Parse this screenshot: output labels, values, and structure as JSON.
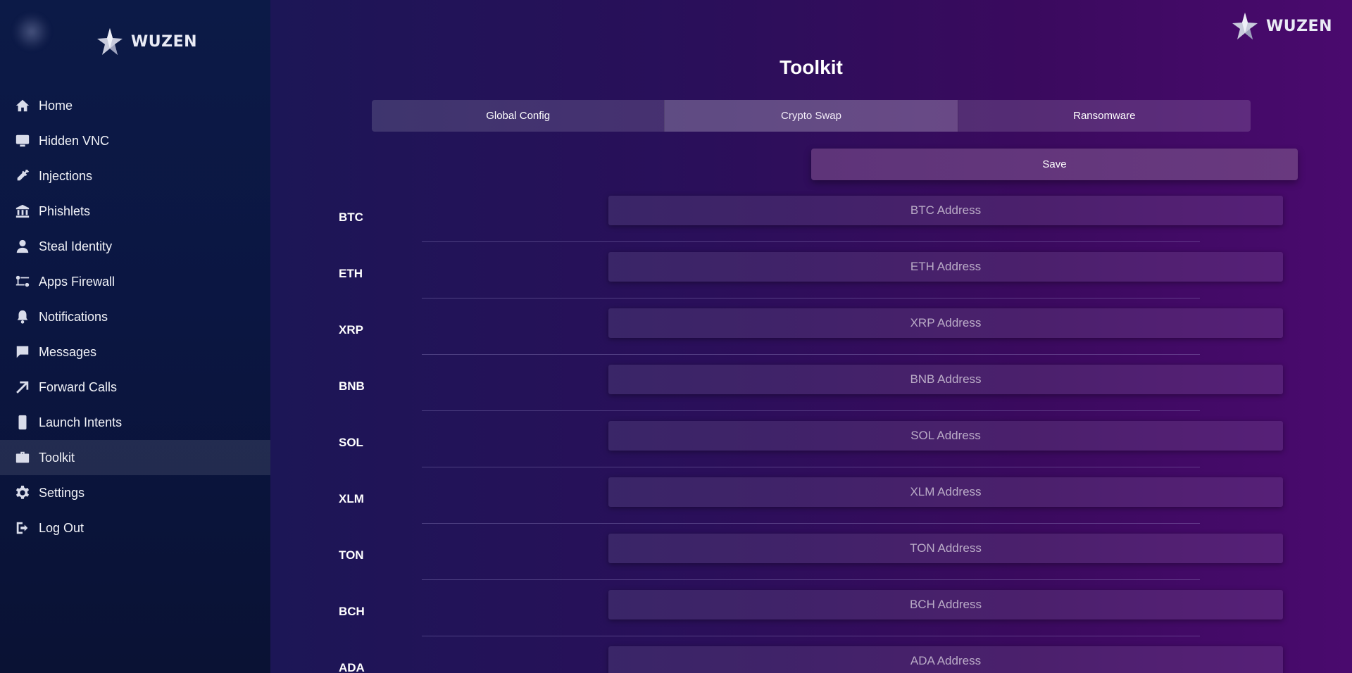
{
  "brand": {
    "name": "WUZEN"
  },
  "sidebar": {
    "items": [
      {
        "label": "Home",
        "icon": "home-icon"
      },
      {
        "label": "Hidden VNC",
        "icon": "monitor-icon"
      },
      {
        "label": "Injections",
        "icon": "syringe-icon"
      },
      {
        "label": "Phishlets",
        "icon": "bank-icon"
      },
      {
        "label": "Steal Identity",
        "icon": "user-icon"
      },
      {
        "label": "Apps Firewall",
        "icon": "firewall-icon"
      },
      {
        "label": "Notifications",
        "icon": "bell-icon"
      },
      {
        "label": "Messages",
        "icon": "message-icon"
      },
      {
        "label": "Forward Calls",
        "icon": "arrow-up-right-icon"
      },
      {
        "label": "Launch Intents",
        "icon": "phone-icon"
      },
      {
        "label": "Toolkit",
        "icon": "briefcase-icon",
        "active": true
      },
      {
        "label": "Settings",
        "icon": "gear-icon"
      },
      {
        "label": "Log Out",
        "icon": "logout-icon"
      }
    ]
  },
  "main": {
    "title": "Toolkit",
    "tabs": [
      {
        "label": "Global Config"
      },
      {
        "label": "Crypto Swap",
        "active": true
      },
      {
        "label": "Ransomware"
      }
    ],
    "save_label": "Save",
    "coins": [
      {
        "label": "BTC",
        "placeholder": "BTC Address"
      },
      {
        "label": "ETH",
        "placeholder": "ETH Address"
      },
      {
        "label": "XRP",
        "placeholder": "XRP Address"
      },
      {
        "label": "BNB",
        "placeholder": "BNB Address"
      },
      {
        "label": "SOL",
        "placeholder": "SOL Address"
      },
      {
        "label": "XLM",
        "placeholder": "XLM Address"
      },
      {
        "label": "TON",
        "placeholder": "TON Address"
      },
      {
        "label": "BCH",
        "placeholder": "BCH Address"
      },
      {
        "label": "ADA",
        "placeholder": "ADA Address"
      }
    ]
  },
  "colors": {
    "sidebar_bg": "#0c1a47",
    "main_bg_start": "#1c1656",
    "main_bg_end": "#4a0a6e",
    "save_button": "#65377c"
  }
}
